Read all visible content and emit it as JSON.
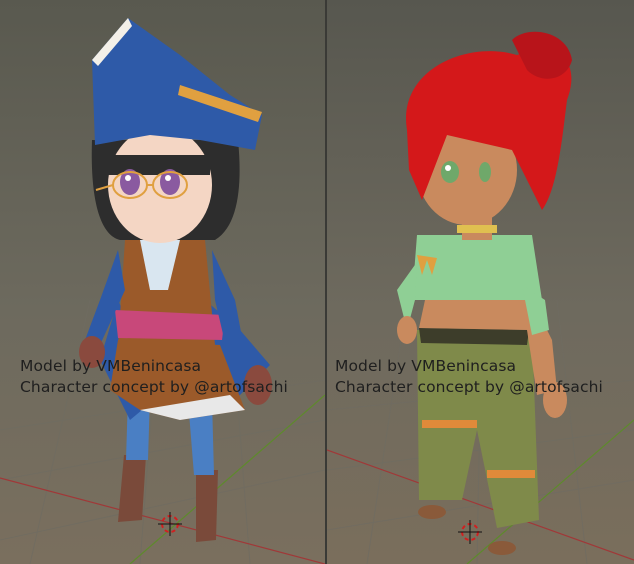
{
  "viewports": [
    {
      "id": "left",
      "character": "pirate-girl",
      "credit_model": "Model by VMBenincasa",
      "credit_concept": "Character concept by @artofsachi"
    },
    {
      "id": "right",
      "character": "red-haired-girl",
      "credit_model": "Model by VMBenincasa",
      "credit_concept": "Character concept by @artofsachi"
    }
  ],
  "colors": {
    "background_top": "#58584f",
    "background_bottom": "#7a6e5c",
    "grid_line": "#6f6f66",
    "axis_x": "#a03838",
    "axis_y": "#5e8a2c",
    "hat_blue": "#2e5aa8",
    "hat_trim_orange": "#e0a040",
    "hair_black": "#2d2d2d",
    "vest_brown": "#9b5a2a",
    "sash_pink": "#c8487a",
    "pants_blue": "#4a7fc4",
    "boots_brown": "#7a4a3a",
    "hair_red": "#d4181a",
    "skin_tan": "#c98a5e",
    "top_green": "#8fcf95",
    "pants_olive": "#7f8a4a",
    "cursor_red": "#d02020"
  }
}
